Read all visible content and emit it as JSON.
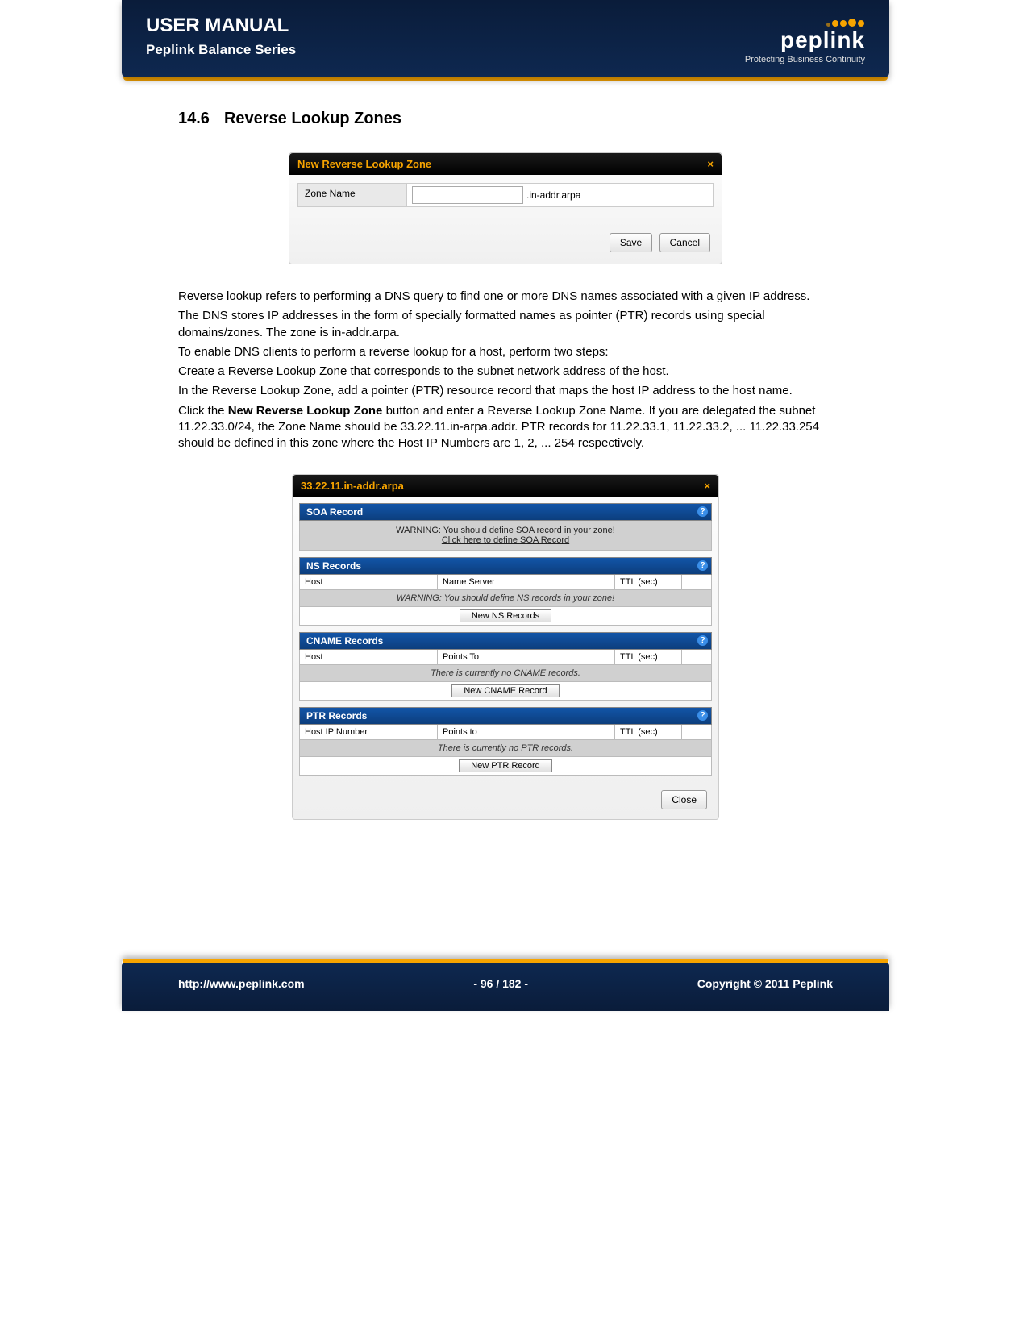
{
  "header": {
    "title": "USER MANUAL",
    "subtitle": "Peplink Balance Series",
    "brand": "peplink",
    "tagline": "Protecting Business Continuity"
  },
  "section": {
    "number": "14.6",
    "title": "Reverse Lookup Zones"
  },
  "fig1": {
    "title": "New Reverse Lookup Zone",
    "close": "×",
    "zone_label": "Zone Name",
    "suffix": ".in-addr.arpa",
    "save": "Save",
    "cancel": "Cancel"
  },
  "paragraphs": {
    "p1": "Reverse lookup refers to performing a DNS query to find one or more DNS names associated with a given IP address.",
    "p2": "The DNS stores IP addresses in the form of specially formatted names as pointer (PTR) records using special domains/zones. The zone is in-addr.arpa.",
    "p3": "To enable DNS clients to perform a reverse lookup for a host, perform two steps:",
    "p4": "Create a Reverse Lookup Zone that corresponds to the subnet network address of the host.",
    "p5": "In the Reverse Lookup Zone, add a pointer (PTR) resource record that maps the host IP address to the host name.",
    "p6a": "Click the ",
    "p6b": "New Reverse Lookup Zone",
    "p6c": " button and enter a Reverse Lookup Zone Name. If you are delegated the subnet 11.22.33.0/24, the Zone Name should be 33.22.11.in-arpa.addr.  PTR records for 11.22.33.1, 11.22.33.2, ... 11.22.33.254 should be defined in this zone where the Host IP Numbers are 1, 2, ... 254 respectively."
  },
  "fig2": {
    "title": "33.22.11.in-addr.arpa",
    "close_x": "×",
    "soa": {
      "title": "SOA Record",
      "warn": "WARNING: You should define SOA record in your zone!",
      "link": "Click here to define SOA Record"
    },
    "ns": {
      "title": "NS Records",
      "h1": "Host",
      "h2": "Name Server",
      "h3": "TTL (sec)",
      "warn": "WARNING: You should define NS records in your zone!",
      "btn": "New NS Records"
    },
    "cname": {
      "title": "CNAME Records",
      "h1": "Host",
      "h2": "Points To",
      "h3": "TTL (sec)",
      "empty": "There is currently no CNAME records.",
      "btn": "New CNAME Record"
    },
    "ptr": {
      "title": "PTR Records",
      "h1": "Host IP Number",
      "h2": "Points to",
      "h3": "TTL (sec)",
      "empty": "There is currently no PTR records.",
      "btn": "New PTR Record"
    },
    "close": "Close"
  },
  "footer": {
    "url": "http://www.peplink.com",
    "page": "- 96 / 182 -",
    "copyright": "Copyright © 2011 Peplink"
  }
}
